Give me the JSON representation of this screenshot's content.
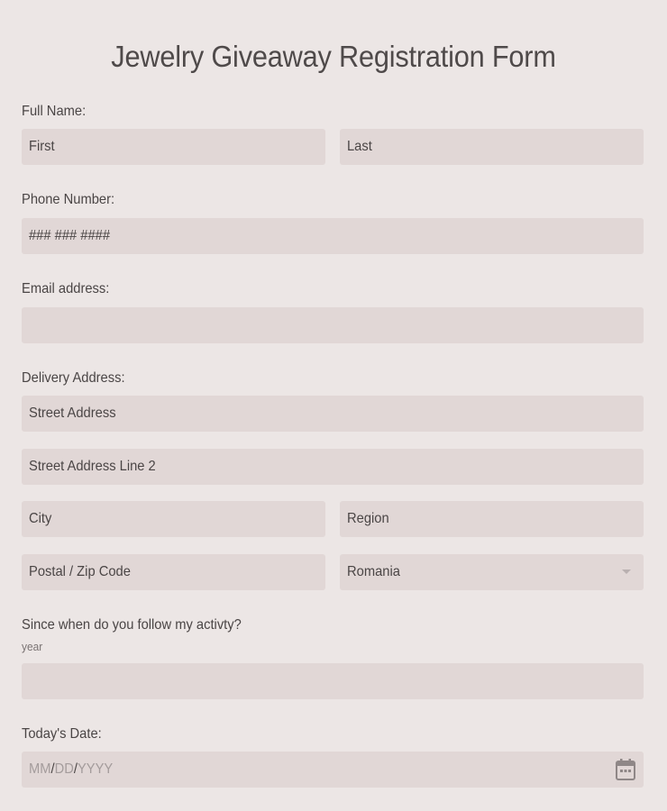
{
  "form": {
    "title": "Jewelry Giveaway Registration Form",
    "full_name": {
      "label": "Full Name:",
      "first_placeholder": "First",
      "last_placeholder": "Last"
    },
    "phone": {
      "label": "Phone Number:",
      "placeholder": "### ### ####"
    },
    "email": {
      "label": "Email address:",
      "value": ""
    },
    "delivery": {
      "label": "Delivery Address:",
      "street_placeholder": "Street Address",
      "street2_placeholder": "Street Address Line 2",
      "city_placeholder": "City",
      "region_placeholder": "Region",
      "postal_placeholder": "Postal / Zip Code",
      "country_selected": "Romania"
    },
    "follow": {
      "label": "Since when do you follow my activty?",
      "sublabel": "year",
      "value": ""
    },
    "date": {
      "label": "Today's Date:",
      "mm": "MM",
      "dd": "DD",
      "yyyy": "YYYY",
      "sep": "/",
      "icon": "calendar-icon"
    }
  },
  "colors": {
    "background": "#ece6e5",
    "field_background": "#e1d7d6",
    "text": "#4a4545",
    "placeholder_date": "#a49c9c"
  }
}
